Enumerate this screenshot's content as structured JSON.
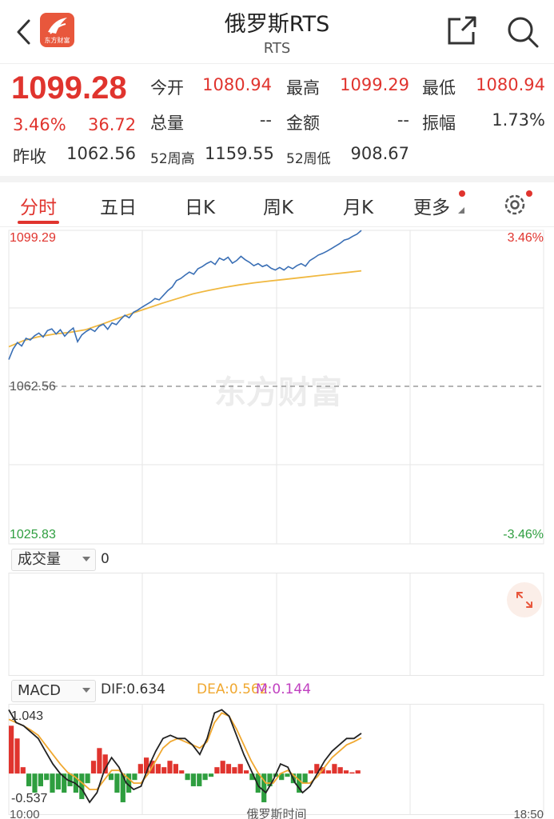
{
  "header": {
    "title": "俄罗斯RTS",
    "subtitle": "RTS",
    "logo_text": "东方财富"
  },
  "quote": {
    "price": "1099.28",
    "change_pct": "3.46%",
    "change_abs": "36.72",
    "open_label": "今开",
    "open_value": "1080.94",
    "high_label": "最高",
    "high_value": "1099.29",
    "low_label": "最低",
    "low_value": "1080.94",
    "volume_label": "总量",
    "volume_value": "--",
    "amount_label": "金额",
    "amount_value": "--",
    "amplitude_label": "振幅",
    "amplitude_value": "1.73%",
    "prev_close_label": "昨收",
    "prev_close_value": "1062.56",
    "week52_high_label": "52周高",
    "week52_high_value": "1159.55",
    "week52_low_label": "52周低",
    "week52_low_value": "908.67"
  },
  "tabs": [
    {
      "label": "分时",
      "active": true
    },
    {
      "label": "五日",
      "active": false
    },
    {
      "label": "日K",
      "active": false
    },
    {
      "label": "周K",
      "active": false
    },
    {
      "label": "月K",
      "active": false
    },
    {
      "label": "更多",
      "active": false
    }
  ],
  "colors": {
    "up": "#e0342e",
    "down": "#2e9e3f",
    "price_line": "#3a6fb5",
    "avg_line": "#f0b840",
    "dea": "#f0a830",
    "macd_m": "#c040c0"
  },
  "volume": {
    "indicator": "成交量",
    "value": "0"
  },
  "macd": {
    "indicator": "MACD",
    "dif": "DIF:0.634",
    "dea": "DEA:0.562",
    "m": "M:0.144"
  },
  "watermark": "东方财富",
  "chart_data": [
    {
      "type": "line",
      "title": "",
      "prev_close": 1062.56,
      "y_labels": {
        "top": "1099.29",
        "mid": "1062.56",
        "bottom": "1025.83",
        "top_pct": "3.46%",
        "bottom_pct": "-3.46%"
      },
      "ylim": [
        1025.83,
        1099.29
      ],
      "x_labels": [
        "10:00",
        "俄罗斯时间",
        "18:50"
      ],
      "grid": true,
      "series": [
        {
          "key": "price",
          "values": [
            1069.0,
            1071.5,
            1073.0,
            1072.2,
            1074.0,
            1073.6,
            1074.6,
            1075.2,
            1074.3,
            1075.8,
            1076.2,
            1075.0,
            1076.0,
            1074.5,
            1075.6,
            1076.4,
            1073.2,
            1074.8,
            1075.6,
            1076.2,
            1075.6,
            1076.8,
            1077.3,
            1076.1,
            1077.6,
            1077.2,
            1078.4,
            1079.4,
            1078.8,
            1080.1,
            1080.6,
            1081.3,
            1081.9,
            1082.5,
            1083.3,
            1083.0,
            1084.1,
            1085.2,
            1086.0,
            1087.5,
            1088.0,
            1088.8,
            1089.5,
            1089.0,
            1090.3,
            1090.8,
            1091.5,
            1092.0,
            1091.3,
            1092.8,
            1092.3,
            1093.0,
            1091.6,
            1092.2,
            1093.2,
            1092.4,
            1091.8,
            1091.0,
            1091.5,
            1090.8,
            1091.2,
            1090.4,
            1090.0,
            1090.6,
            1090.0,
            1090.8,
            1090.3,
            1091.0,
            1091.5,
            1090.9,
            1092.2,
            1092.8,
            1093.5,
            1093.9,
            1094.4,
            1095.0,
            1095.6,
            1096.2,
            1097.0,
            1097.3,
            1097.9,
            1098.4,
            1099.28
          ]
        },
        {
          "key": "avg",
          "values": [
            1072.0,
            1073.5,
            1074.4,
            1075.0,
            1075.4,
            1076.0,
            1077.2,
            1078.5,
            1079.8,
            1081.0,
            1082.2,
            1083.3,
            1084.4,
            1085.2,
            1085.9,
            1086.5,
            1087.0,
            1087.4,
            1087.8,
            1088.2,
            1088.6,
            1089.0,
            1089.4,
            1089.8
          ]
        }
      ]
    },
    {
      "type": "bar",
      "title": "MACD",
      "y_labels": {
        "top": "1.043",
        "bottom": "-0.537"
      },
      "ylim": [
        -0.537,
        1.043
      ],
      "series": [
        {
          "key": "macd_bars",
          "values": [
            0.75,
            0.55,
            0.1,
            -0.2,
            -0.3,
            -0.2,
            -0.1,
            -0.3,
            -0.25,
            -0.3,
            -0.2,
            -0.3,
            -0.4,
            -0.15,
            0.2,
            0.4,
            0.3,
            -0.1,
            -0.3,
            -0.45,
            -0.3,
            -0.1,
            0.15,
            0.25,
            0.2,
            0.15,
            0.1,
            0.2,
            0.15,
            0.05,
            -0.1,
            -0.2,
            -0.2,
            -0.1,
            -0.05,
            0.1,
            0.2,
            0.15,
            0.1,
            0.15,
            0.05,
            -0.1,
            -0.3,
            -0.45,
            -0.2,
            -0.05,
            -0.1,
            -0.05,
            -0.15,
            -0.3,
            -0.15,
            0.05,
            0.15,
            0.1,
            0.05,
            0.15,
            0.1,
            0.05,
            0.02,
            0.05
          ]
        },
        {
          "key": "dif",
          "values": [
            1.0,
            0.8,
            0.75,
            0.65,
            0.55,
            0.35,
            0.15,
            0.0,
            -0.1,
            -0.15,
            -0.25,
            -0.45,
            -0.3,
            0.05,
            0.25,
            0.1,
            -0.15,
            -0.25,
            -0.2,
            0.1,
            0.35,
            0.55,
            0.6,
            0.55,
            0.55,
            0.45,
            0.3,
            0.55,
            0.95,
            1.0,
            0.9,
            0.6,
            0.3,
            0.05,
            -0.2,
            -0.3,
            -0.1,
            0.15,
            0.1,
            -0.15,
            -0.3,
            -0.2,
            0.0,
            0.2,
            0.35,
            0.45,
            0.55,
            0.55,
            0.63
          ]
        },
        {
          "key": "dea",
          "values": [
            0.85,
            0.8,
            0.75,
            0.68,
            0.6,
            0.45,
            0.3,
            0.15,
            0.02,
            -0.05,
            -0.15,
            -0.25,
            -0.25,
            -0.1,
            0.05,
            0.05,
            -0.05,
            -0.15,
            -0.15,
            0.0,
            0.2,
            0.4,
            0.5,
            0.55,
            0.5,
            0.45,
            0.4,
            0.5,
            0.8,
            0.95,
            0.9,
            0.7,
            0.45,
            0.2,
            0.0,
            -0.15,
            -0.15,
            0.0,
            0.05,
            -0.05,
            -0.15,
            -0.15,
            -0.05,
            0.1,
            0.25,
            0.35,
            0.45,
            0.5,
            0.56
          ]
        }
      ]
    }
  ]
}
